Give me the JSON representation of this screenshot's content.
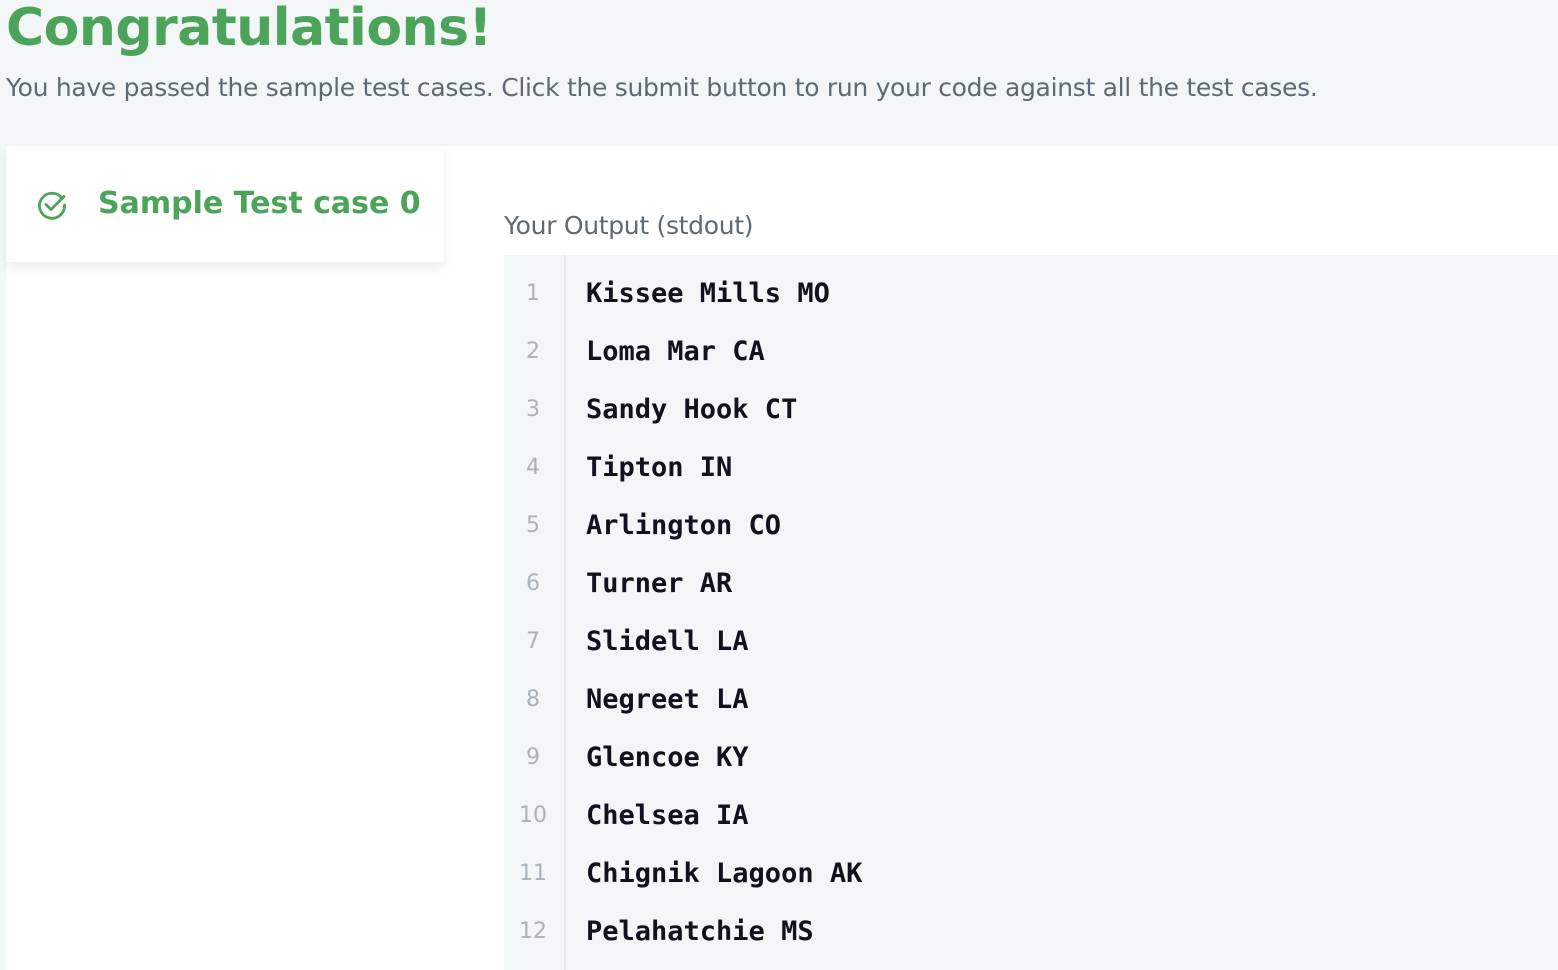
{
  "header": {
    "title": "Congratulations!",
    "message": "You have passed the sample test cases. Click the submit button to run your code against all the test cases."
  },
  "tabs": [
    {
      "label": "Sample Test case 0",
      "icon": "check-circle-icon",
      "status": "passed"
    }
  ],
  "output": {
    "label": "Your Output (stdout)",
    "lines": [
      {
        "num": "1",
        "text": "Kissee Mills MO"
      },
      {
        "num": "2",
        "text": "Loma Mar CA"
      },
      {
        "num": "3",
        "text": "Sandy Hook CT"
      },
      {
        "num": "4",
        "text": "Tipton IN"
      },
      {
        "num": "5",
        "text": "Arlington CO"
      },
      {
        "num": "6",
        "text": "Turner AR"
      },
      {
        "num": "7",
        "text": "Slidell LA"
      },
      {
        "num": "8",
        "text": "Negreet LA"
      },
      {
        "num": "9",
        "text": "Glencoe KY"
      },
      {
        "num": "10",
        "text": "Chelsea IA"
      },
      {
        "num": "11",
        "text": "Chignik Lagoon AK"
      },
      {
        "num": "12",
        "text": "Pelahatchie MS"
      }
    ]
  },
  "colors": {
    "success": "#4ca35a",
    "muted_text": "#5e6a73",
    "code_text": "#0e141e",
    "code_bg": "#f3f6f7"
  }
}
